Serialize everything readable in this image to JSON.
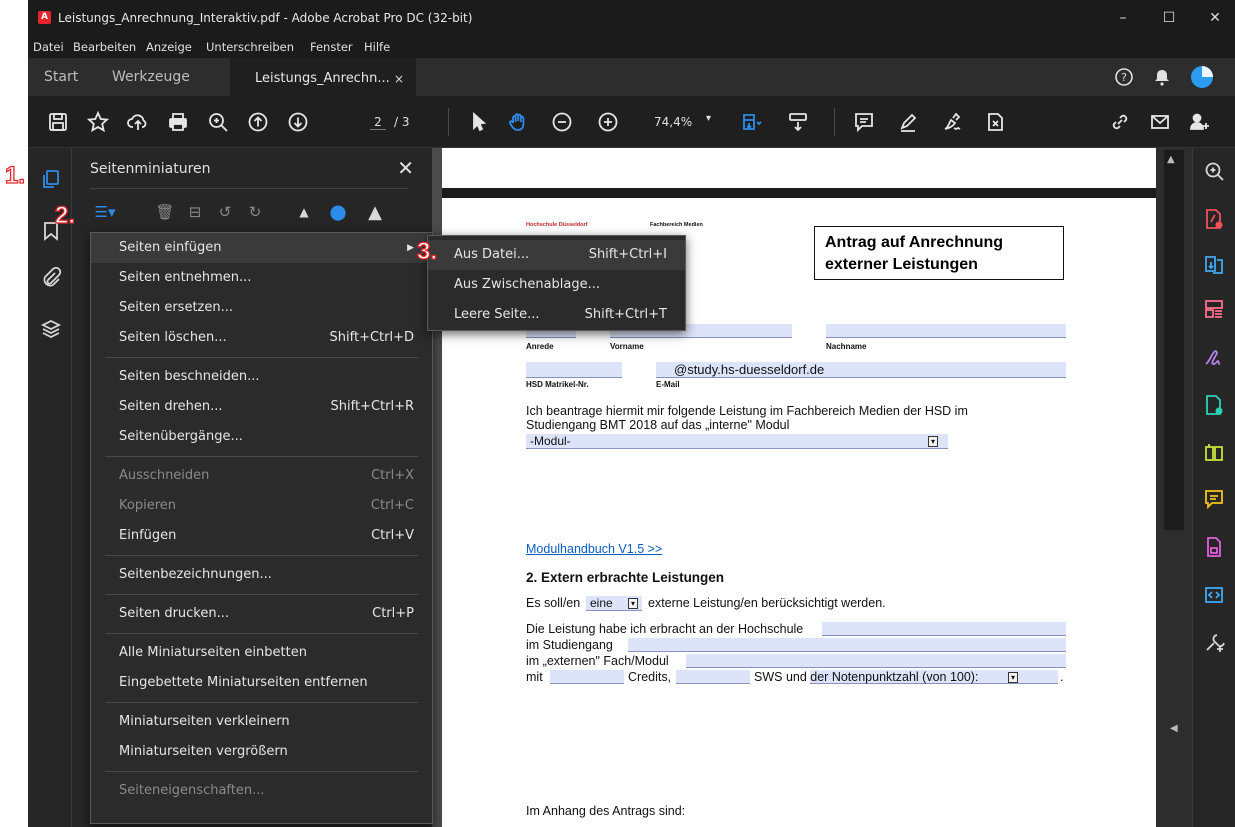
{
  "window": {
    "title": "Leistungs_Anrechnung_Interaktiv.pdf - Adobe Acrobat Pro DC (32-bit)",
    "app_icon": "acrobat-icon",
    "controls": {
      "minimize": "–",
      "maximize": "☐",
      "close": "✕"
    }
  },
  "menubar": [
    "Datei",
    "Bearbeiten",
    "Anzeige",
    "Unterschreiben",
    "Fenster",
    "Hilfe"
  ],
  "tabs": {
    "start": "Start",
    "tools": "Werkzeuge",
    "document": "Leistungs_Anrechn...",
    "close": "×"
  },
  "toolbar": {
    "page_current": "2",
    "page_total": "/ 3",
    "zoom": "74,4%"
  },
  "panel": {
    "title": "Seitenminiaturen",
    "close": "✕"
  },
  "context_menu": [
    {
      "label": "Seiten einfügen",
      "shortcut": "",
      "submenu": true,
      "disabled": false,
      "highlighted": true
    },
    {
      "label": "Seiten entnehmen...",
      "shortcut": "",
      "disabled": false
    },
    {
      "label": "Seiten ersetzen...",
      "shortcut": "",
      "disabled": false
    },
    {
      "label": "Seiten löschen...",
      "shortcut": "Shift+Ctrl+D",
      "disabled": false
    },
    {
      "sep": true
    },
    {
      "label": "Seiten beschneiden...",
      "shortcut": "",
      "disabled": false
    },
    {
      "label": "Seiten drehen...",
      "shortcut": "Shift+Ctrl+R",
      "disabled": false
    },
    {
      "label": "Seitenübergänge...",
      "shortcut": "",
      "disabled": false
    },
    {
      "sep": true
    },
    {
      "label": "Ausschneiden",
      "shortcut": "Ctrl+X",
      "disabled": true
    },
    {
      "label": "Kopieren",
      "shortcut": "Ctrl+C",
      "disabled": true
    },
    {
      "label": "Einfügen",
      "shortcut": "Ctrl+V",
      "disabled": false
    },
    {
      "sep": true
    },
    {
      "label": "Seitenbezeichnungen...",
      "shortcut": "",
      "disabled": false
    },
    {
      "sep": true
    },
    {
      "label": "Seiten drucken...",
      "shortcut": "Ctrl+P",
      "disabled": false
    },
    {
      "sep": true
    },
    {
      "label": "Alle Miniaturseiten einbetten",
      "shortcut": "",
      "disabled": false
    },
    {
      "label": "Eingebettete Miniaturseiten entfernen",
      "shortcut": "",
      "disabled": false
    },
    {
      "sep": true
    },
    {
      "label": "Miniaturseiten verkleinern",
      "shortcut": "",
      "disabled": false
    },
    {
      "label": "Miniaturseiten vergrößern",
      "shortcut": "",
      "disabled": false
    },
    {
      "sep": true
    },
    {
      "label": "Seiteneigenschaften...",
      "shortcut": "",
      "disabled": true
    }
  ],
  "submenu": [
    {
      "label": "Aus Datei...",
      "shortcut": "Shift+Ctrl+I"
    },
    {
      "label": "Aus Zwischenablage...",
      "shortcut": ""
    },
    {
      "label": "Leere Seite...",
      "shortcut": "Shift+Ctrl+T"
    }
  ],
  "annotations": {
    "one": "1.",
    "two": "2.",
    "three": "3."
  },
  "document": {
    "header_left": "Hochschule Düsseldorf",
    "header_right": "Fachbereich Medien",
    "title": "Antrag auf Anrechnung externer Leistungen",
    "label_anrede": "Anrede",
    "label_vorname": "Vorname",
    "label_nachname": "Nachname",
    "label_matrikel": "HSD Matrikel-Nr.",
    "label_email": "E-Mail",
    "email_value": "@study.hs-duesseldorf.de",
    "intro": "Ich beantrage hiermit mir folgende Leistung im Fachbereich Medien der HSD im",
    "intro2": "Studiengang BMT 2018 auf das „interne\" Modul",
    "modul_select": "-Modul-",
    "link": "Modulhandbuch V1.5 >>",
    "section2": "2. Extern erbrachte Leistungen",
    "line1_a": "Es soll/en",
    "line1_select": "eine",
    "line1_b": "externe Leistung/en berücksichtigt werden.",
    "line2": "Die Leistung habe ich erbracht an der Hochschule",
    "line3": "im Studiengang",
    "line4": "im „externen\" Fach/Modul",
    "line5_a": "mit",
    "line5_b": "Credits,",
    "line5_c": "SWS und der Notenpunktzahl (von 100):",
    "line5_end": ".",
    "anhang": "Im Anhang des Antrags sind:"
  }
}
